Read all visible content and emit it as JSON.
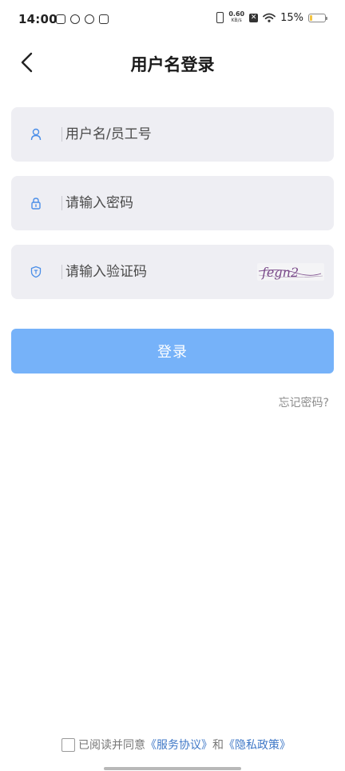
{
  "status_bar": {
    "time": "14:00",
    "net_speed_value": "0.60",
    "net_speed_unit": "KB/s",
    "x_glyph": "✕",
    "battery_percent": "15%",
    "battery_level": 0.15,
    "battery_color": "#f3c441",
    "left_icons": [
      "app-notification-icon",
      "leaf-icon",
      "face-icon",
      "calendar-icon"
    ],
    "right_icons": [
      "vibrate-icon",
      "sim-x-icon",
      "wifi-icon",
      "battery-icon"
    ]
  },
  "header": {
    "title": "用户名登录",
    "back_icon": "chevron-left-icon"
  },
  "form": {
    "username_placeholder": "用户名/员工号",
    "password_placeholder": "请输入密码",
    "captcha_placeholder": "请输入验证码",
    "captcha_image_text": "fegn2",
    "username_icon": "user-icon",
    "password_icon": "lock-icon",
    "captcha_icon": "shield-icon"
  },
  "login_button": {
    "label": "登录",
    "color": "#76b2f9"
  },
  "forgot_password": "忘记密码?",
  "agreement": {
    "prefix": "已阅读并同意",
    "service_link": "《服务协议》",
    "and": "和",
    "privacy_link": "《隐私政策》",
    "link_color": "#3f78c7"
  }
}
